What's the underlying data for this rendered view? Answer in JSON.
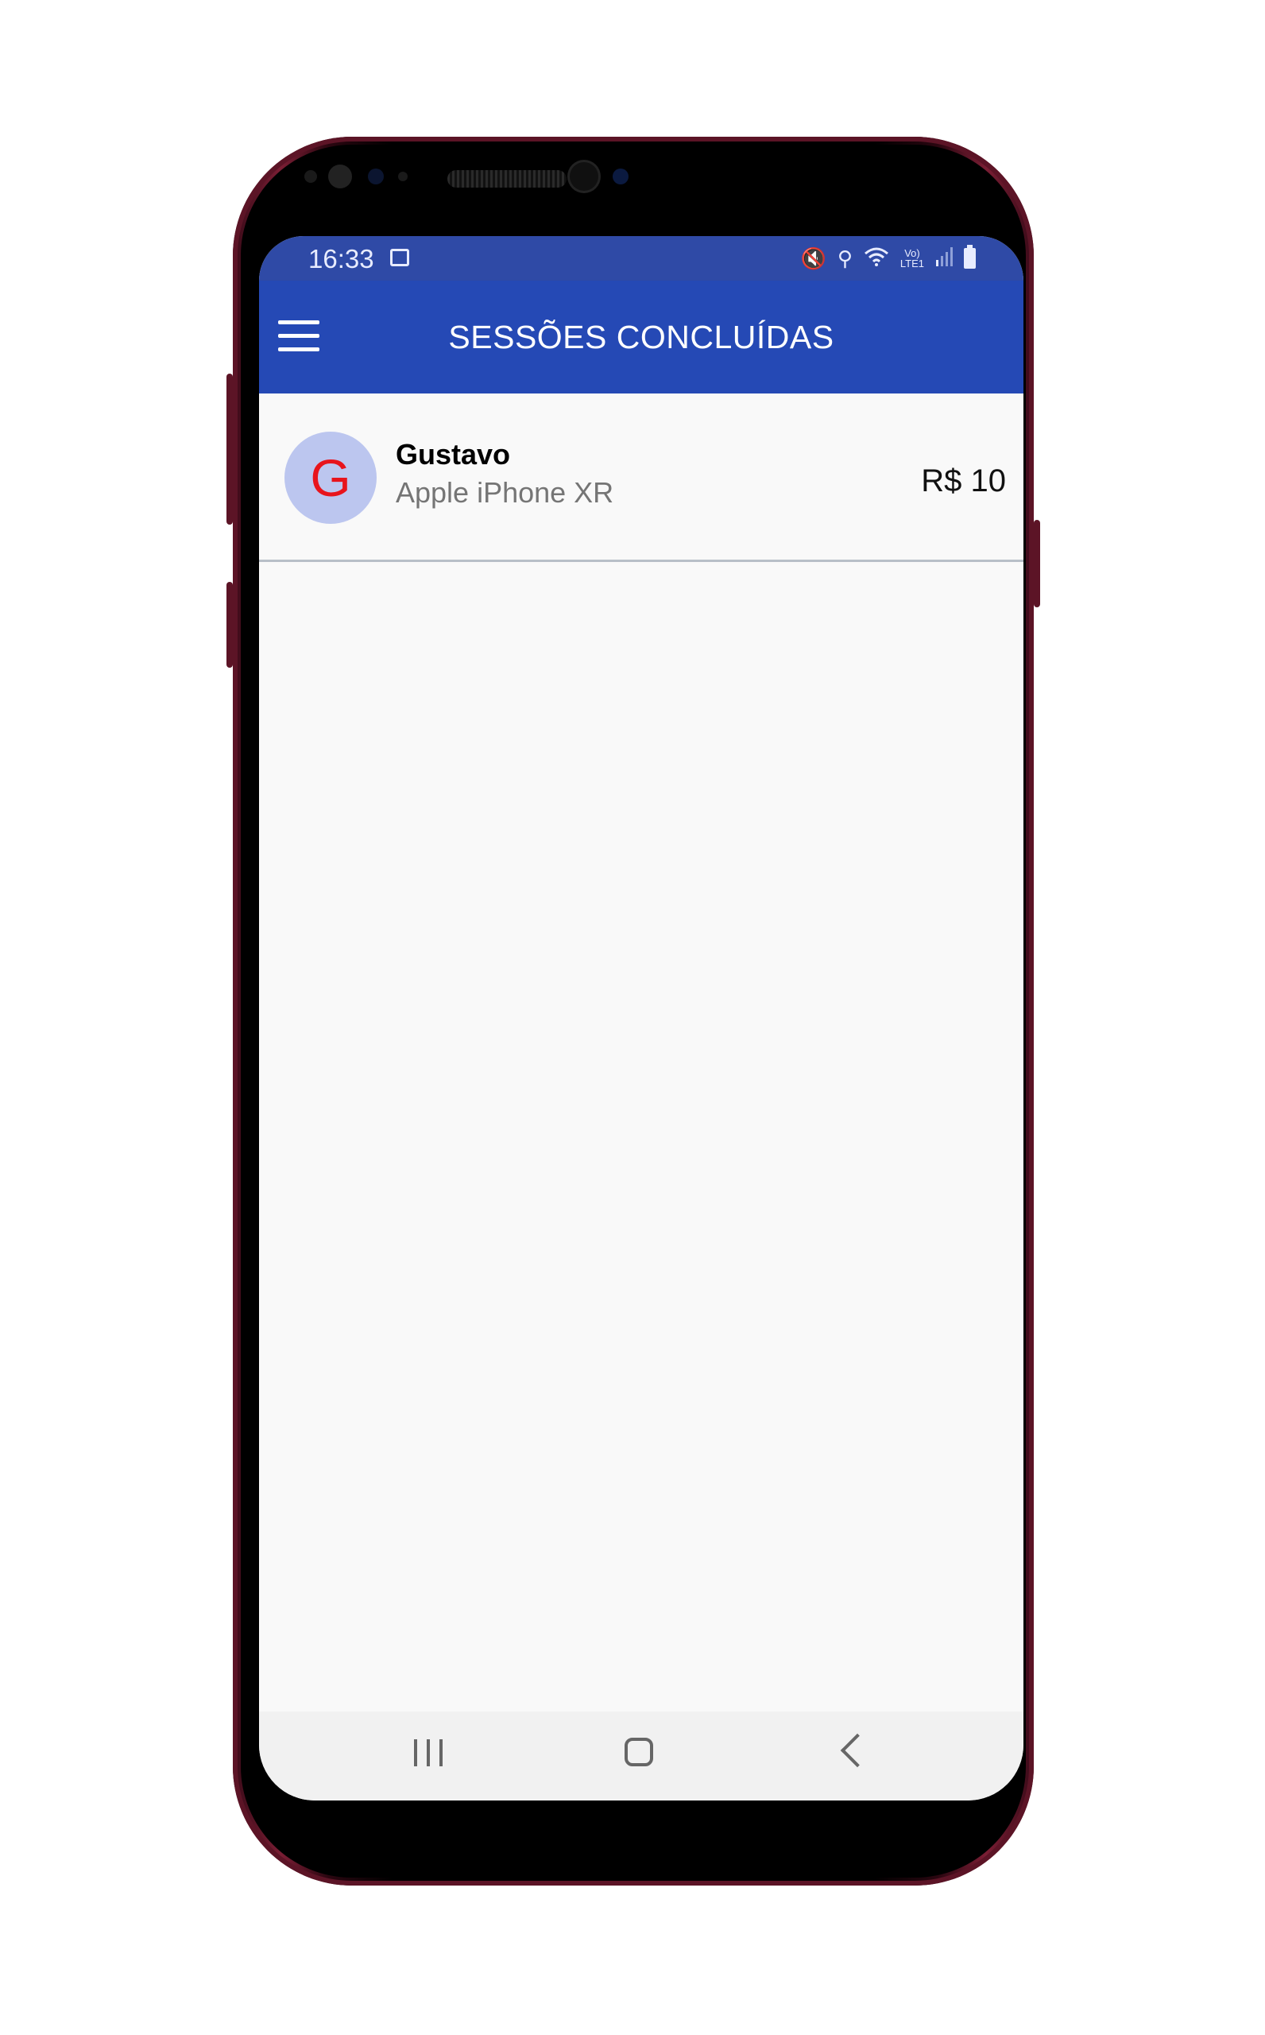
{
  "status_bar": {
    "time": "16:33",
    "network_label": "Vo)\nLTE1"
  },
  "app_bar": {
    "title": "SESSÕES CONCLUÍDAS"
  },
  "sessions": [
    {
      "avatar_letter": "G",
      "name": "Gustavo",
      "device": "Apple iPhone XR",
      "price": "R$ 10"
    }
  ],
  "colors": {
    "status_bar": "#2f4aa6",
    "app_bar": "#2549b5",
    "avatar_bg": "#bcc6ef",
    "avatar_letter": "#e8141c",
    "phone_frame": "#5c1426"
  },
  "icons": {
    "menu": "hamburger-menu-icon",
    "gallery": "image-icon",
    "mute": "volume-mute-icon",
    "location": "location-pin-icon",
    "wifi": "wifi-icon",
    "signal": "signal-bars-icon",
    "battery": "battery-icon",
    "recent": "recent-apps-icon",
    "home": "home-icon",
    "back": "back-icon"
  }
}
